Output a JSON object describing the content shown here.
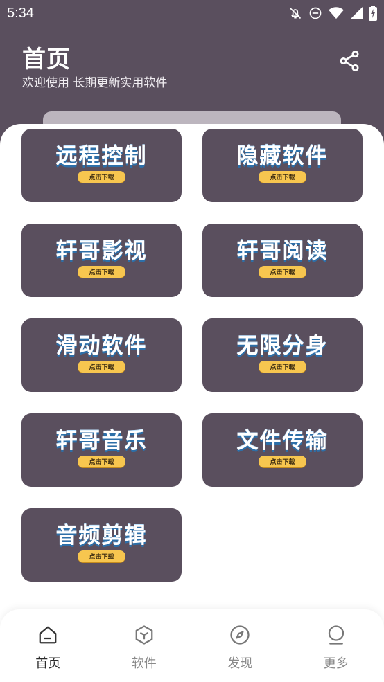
{
  "status": {
    "time": "5:34",
    "icons": [
      "bell-off-icon",
      "do-not-disturb-icon",
      "wifi-icon",
      "signal-icon",
      "battery-charging-icon"
    ]
  },
  "header": {
    "title": "首页",
    "subtitle": "欢迎使用 长期更新实用软件",
    "share_icon": "share-icon"
  },
  "colors": {
    "primary": "#5a4f5e",
    "button": "#f7c64f",
    "title_shadow": "#2d6fa8"
  },
  "cards": [
    {
      "title": "远程控制",
      "button": "点击下载"
    },
    {
      "title": "隐藏软件",
      "button": "点击下载"
    },
    {
      "title": "轩哥影视",
      "button": "点击下载"
    },
    {
      "title": "轩哥阅读",
      "button": "点击下载"
    },
    {
      "title": "滑动软件",
      "button": "点击下载"
    },
    {
      "title": "无限分身",
      "button": "点击下载"
    },
    {
      "title": "轩哥音乐",
      "button": "点击下载"
    },
    {
      "title": "文件传输",
      "button": "点击下载"
    },
    {
      "title": "音频剪辑",
      "button": "点击下载"
    }
  ],
  "nav": [
    {
      "label": "首页",
      "icon": "home-icon",
      "active": true
    },
    {
      "label": "软件",
      "icon": "cube-icon",
      "active": false
    },
    {
      "label": "发现",
      "icon": "compass-icon",
      "active": false
    },
    {
      "label": "更多",
      "icon": "more-icon",
      "active": false
    }
  ]
}
